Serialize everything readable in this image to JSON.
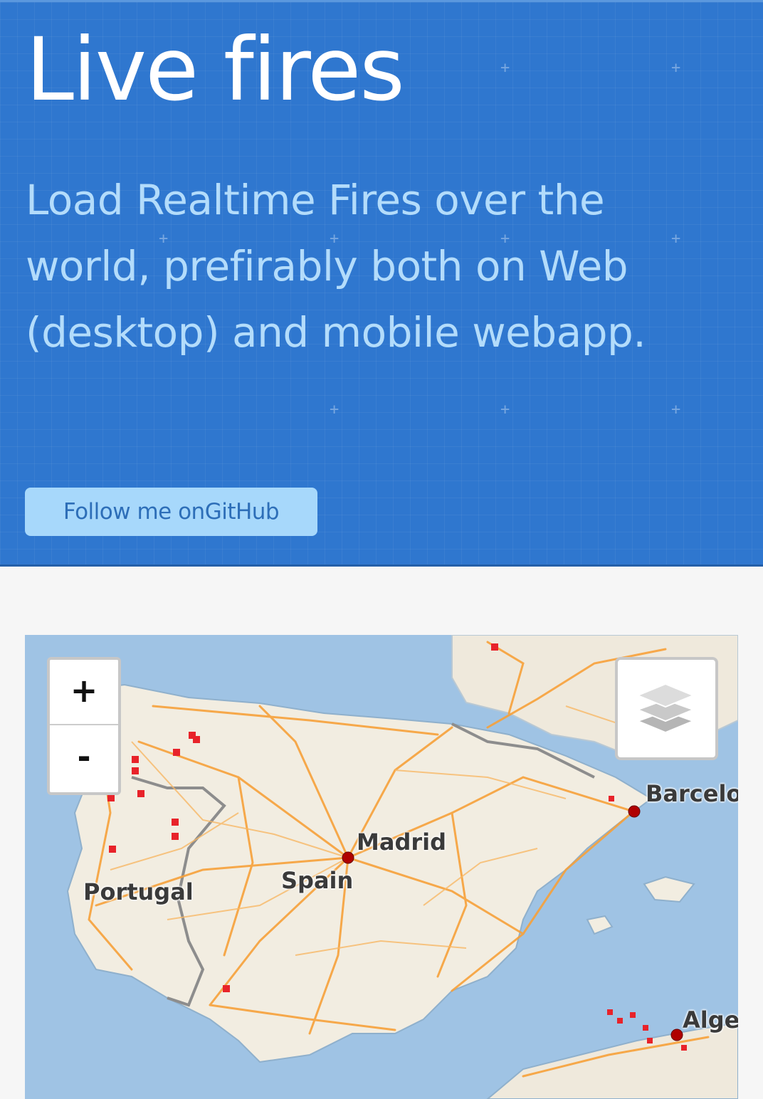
{
  "hero": {
    "title": "Live fires",
    "tagline": "Load Realtime Fires over the world, prefirably both on Web (desktop) and mobile webapp.",
    "button_label": "Follow me onGitHub"
  },
  "map": {
    "zoom_in_label": "+",
    "zoom_out_label": "-",
    "layers_icon": "layers-icon",
    "labels": {
      "barcelona": "Barcelo",
      "madrid": "Madrid",
      "spain": "Spain",
      "portugal": "Portugal",
      "algeria": "Alge"
    },
    "colors": {
      "sea": "#9fc3e4",
      "land": "#f1ece0",
      "roads": "#f7a13a",
      "fire": "#e8232a",
      "city": "#b00000"
    }
  },
  "colors": {
    "hero_bg": "#2f77cf",
    "title": "#ffffff",
    "tagline": "#b3dcfb",
    "button_bg": "#a7d8fb",
    "button_text": "#2d6eb8"
  }
}
